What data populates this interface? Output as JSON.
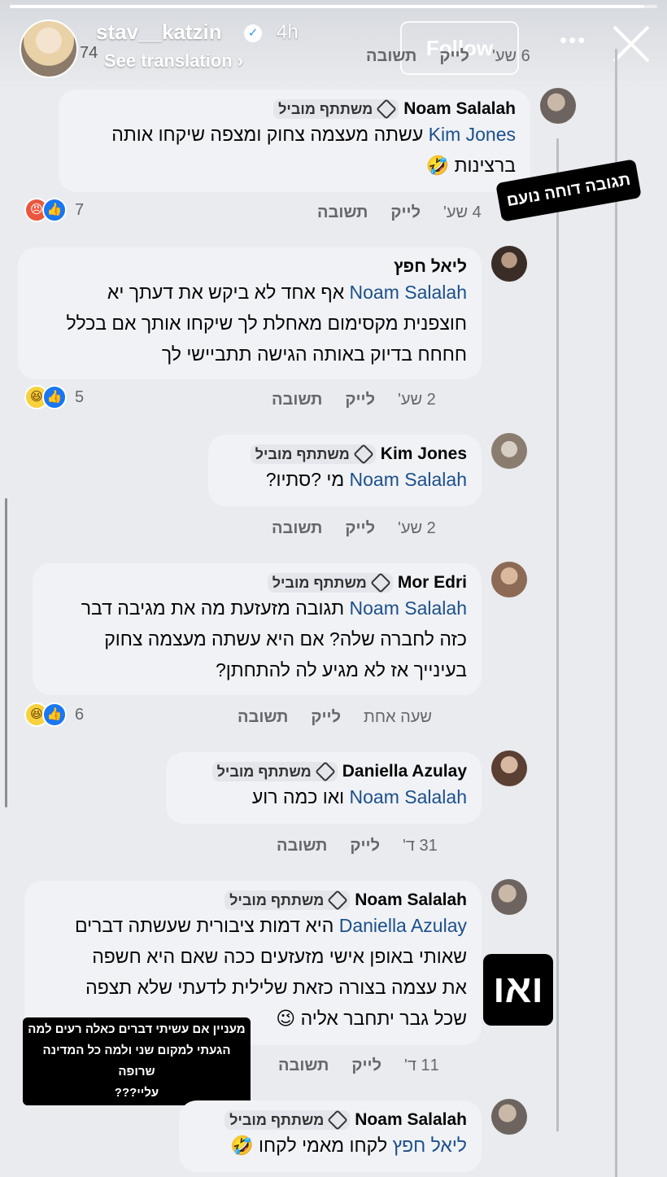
{
  "story": {
    "username": "stav__katzin",
    "time": "4h",
    "follow_label": "Follow",
    "more": "•••",
    "see_translation": "See translation",
    "viewer_count": "74",
    "progress_fraction": 0.98
  },
  "top_row": {
    "time": "6 שע'",
    "like": "לייק",
    "reply": "תשובה"
  },
  "comments": [
    {
      "author": "Noam Salalah",
      "badge": "משתתף מוביל",
      "mention": "Kim Jones",
      "text_lines": [
        "עשתה מעצמה צחוק ומצפה שיקחו אותה",
        "ברצינות 🤣"
      ],
      "time": "4 שע'",
      "like": "לייק",
      "reply": "תשובה",
      "reaction_count": "7"
    },
    {
      "author": "ליאל חפץ",
      "badge": "",
      "mention": "Noam Salalah",
      "text_lines": [
        "אף אחד לא ביקש את דעתך יא",
        "חוצפנית מקסימום מאחלת לך שיקחו אותך אם בכלל",
        "חחחח בדיוק באותה הגישה תתביישי לך"
      ],
      "time": "2 שע'",
      "like": "לייק",
      "reply": "תשובה",
      "reaction_count": "5"
    },
    {
      "author": "Kim Jones",
      "badge": "משתתף מוביל",
      "mention": "Noam Salalah",
      "text_lines": [
        "מי ?סתיו?"
      ],
      "time": "2 שע'",
      "like": "לייק",
      "reply": "תשובה",
      "reaction_count": ""
    },
    {
      "author": "Mor Edri",
      "badge": "משתתף מוביל",
      "mention": "Noam Salalah",
      "text_lines": [
        "תגובה מזעזעת מה את מגיבה דבר",
        "כזה לחברה שלה? אם היא עשתה מעצמה צחוק",
        "בעינייך אז לא מגיע לה להתחתן?"
      ],
      "time": "שעה אחת",
      "like": "לייק",
      "reply": "תשובה",
      "reaction_count": "6"
    },
    {
      "author": "Daniella Azulay",
      "badge": "משתתף מוביל",
      "mention": "Noam Salalah",
      "text_lines": [
        "ואו כמה רוע"
      ],
      "time": "31 ד'",
      "like": "לייק",
      "reply": "תשובה",
      "reaction_count": ""
    },
    {
      "author": "Noam Salalah",
      "badge": "משתתף מוביל",
      "mention": "Daniella Azulay",
      "text_lines": [
        "היא דמות ציבורית שעשתה דברים",
        "שאותי באופן אישי מזעזעים ככה שאם היא חשפה",
        "את עצמה בצורה כזאת שלילית לדעתי שלא תצפה",
        "שכל גבר יתחבר אליה 😉"
      ],
      "time": "11 ד'",
      "like": "לייק",
      "reply": "תשובה",
      "reaction_count": ""
    },
    {
      "author": "Noam Salalah",
      "badge": "משתתף מוביל",
      "mention": "ליאל חפץ",
      "text_lines": [
        "לקחו מאמי לקחו 🤣"
      ],
      "time": "",
      "like": "",
      "reply": "",
      "reaction_count": ""
    }
  ],
  "stickers": {
    "noam_reply": "תגובה דוחה נועם",
    "wow": "ואו",
    "caption": [
      "מעניין אם עשיתי דברים כאלה רעים למה",
      "הגעתי למקום שני ולמה כל המדינה שרופה",
      "עליי???"
    ]
  },
  "colors": {
    "mention": "#1c4f8c",
    "bubble": "#f0f2f5",
    "like": "#1877f2"
  }
}
